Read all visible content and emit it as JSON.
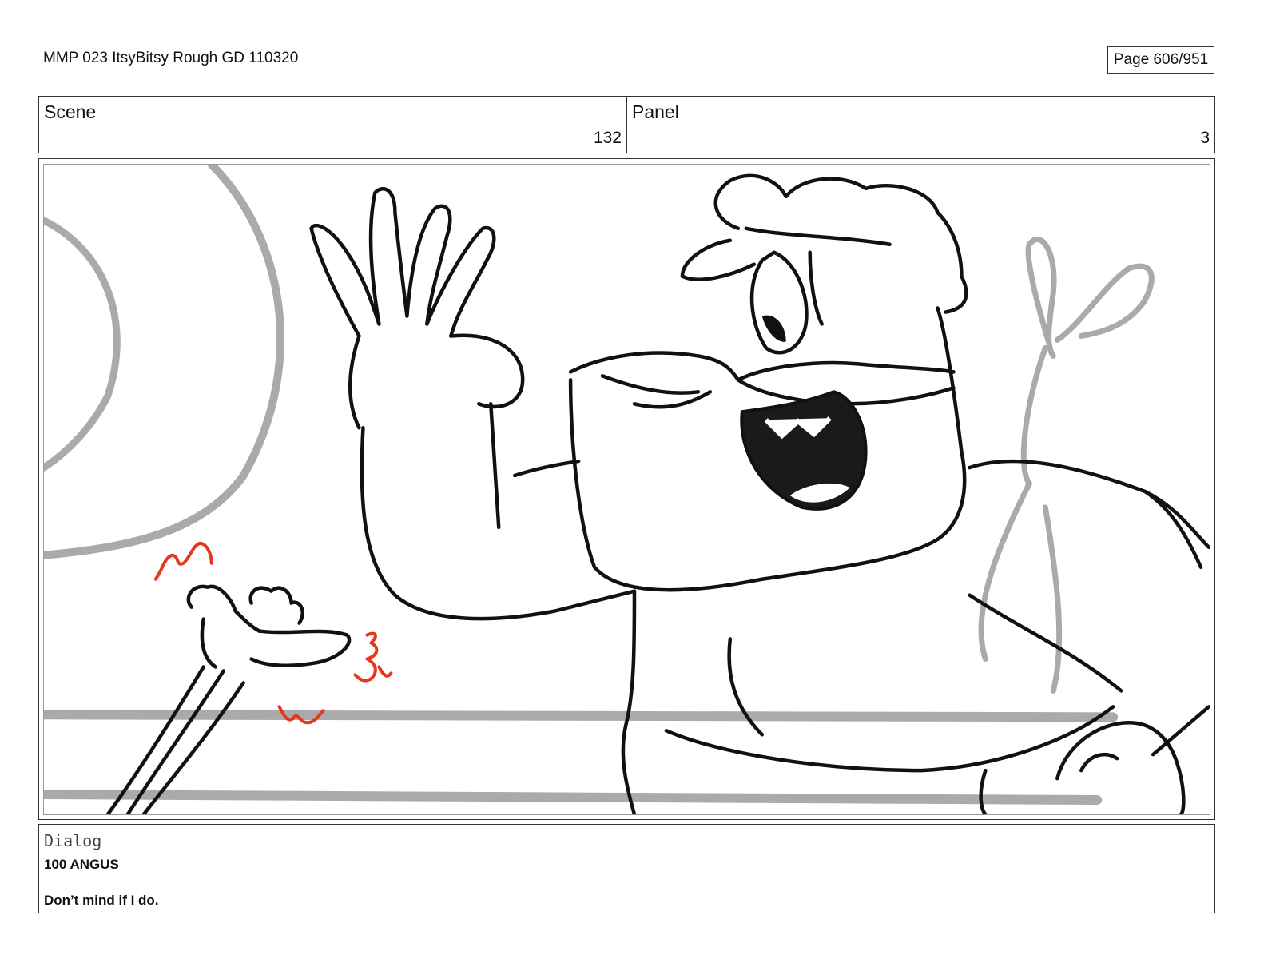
{
  "document": {
    "title": "MMP 023 ItsyBitsy Rough GD 110320",
    "page": "Page 606/951"
  },
  "scene": {
    "label": "Scene",
    "value": "132"
  },
  "panel": {
    "label": "Panel",
    "value": "3"
  },
  "dialog": {
    "label": "Dialog",
    "speaker": "100 ANGUS",
    "line": "Don’t mind if I do."
  },
  "colors": {
    "ink": "#111111",
    "background_sketch": "#aaaaaa",
    "action_marks": "#e8361c"
  }
}
